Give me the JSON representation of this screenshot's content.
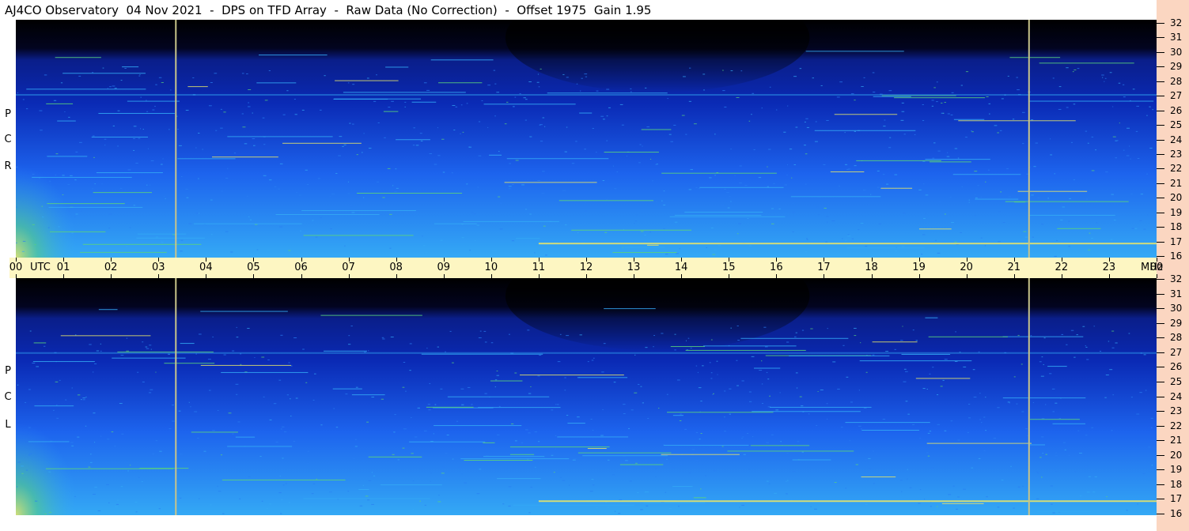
{
  "title": "AJ4CO Observatory  04 Nov 2021  -  DPS on TFD Array  -  Raw Data (No Correction)  -  Offset 1975  Gain 1.95",
  "panels": [
    {
      "label": [
        "P",
        "C",
        "R"
      ]
    },
    {
      "label": [
        "P",
        "C",
        "L"
      ]
    }
  ],
  "x_axis": {
    "ticks": [
      "00",
      "01",
      "02",
      "03",
      "04",
      "05",
      "06",
      "07",
      "08",
      "09",
      "10",
      "11",
      "12",
      "13",
      "14",
      "15",
      "16",
      "17",
      "18",
      "19",
      "20",
      "21",
      "22",
      "23",
      "00"
    ],
    "utc_label": "UTC",
    "unit_label": "MHz"
  },
  "y_axis": {
    "ticks": [
      "32",
      "31",
      "30",
      "29",
      "28",
      "27",
      "26",
      "25",
      "24",
      "23",
      "22",
      "21",
      "20",
      "19",
      "18",
      "17",
      "16"
    ]
  },
  "colors": {
    "background": "#000000",
    "deep_blue": "#0a2ab5",
    "mid_blue": "#1d64ee",
    "light_blue": "#34a9f5",
    "green": "#5ad37a",
    "yellow": "#e3e36b",
    "marker_line": "#c8c48a",
    "axis_bar": "#fdf6c2",
    "right_strip": "#fbd6c1"
  },
  "chart_data": {
    "type": "heatmap",
    "title": "AJ4CO Observatory  04 Nov 2021  -  DPS on TFD Array  -  Raw Data (No Correction)  -  Offset 1975  Gain 1.95",
    "xlabel": "UTC",
    "ylabel": "MHz",
    "x_range": [
      0,
      24
    ],
    "y_range": [
      16,
      32
    ],
    "series": [
      {
        "name": "RCP"
      },
      {
        "name": "LCP"
      }
    ],
    "marker_times_utc": [
      3.35,
      21.3
    ],
    "strong_emission_bands_mhz": [
      {
        "mhz": 17,
        "start_utc": 11.0,
        "end_utc": 24.0
      },
      {
        "mhz": 27,
        "start_utc": 0.0,
        "end_utc": 24.0
      }
    ],
    "bright_region_utc": [
      0.0,
      1.0
    ],
    "grid": false
  }
}
